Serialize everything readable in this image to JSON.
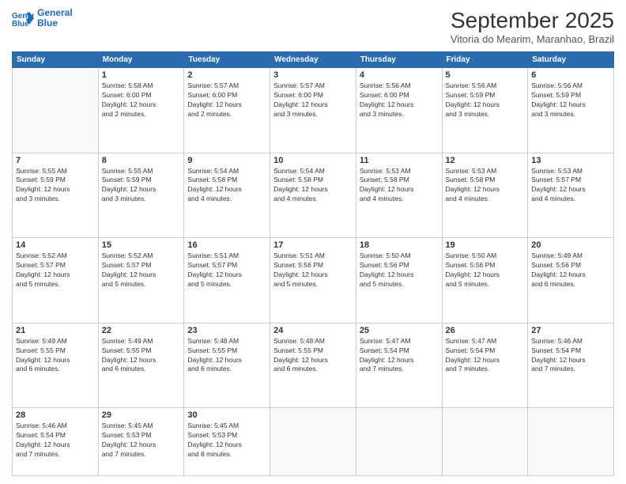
{
  "header": {
    "logo_line1": "General",
    "logo_line2": "Blue",
    "month_title": "September 2025",
    "subtitle": "Vitoria do Mearim, Maranhao, Brazil"
  },
  "days_of_week": [
    "Sunday",
    "Monday",
    "Tuesday",
    "Wednesday",
    "Thursday",
    "Friday",
    "Saturday"
  ],
  "weeks": [
    [
      {
        "day": "",
        "info": ""
      },
      {
        "day": "1",
        "info": "Sunrise: 5:58 AM\nSunset: 6:00 PM\nDaylight: 12 hours\nand 2 minutes."
      },
      {
        "day": "2",
        "info": "Sunrise: 5:57 AM\nSunset: 6:00 PM\nDaylight: 12 hours\nand 2 minutes."
      },
      {
        "day": "3",
        "info": "Sunrise: 5:57 AM\nSunset: 6:00 PM\nDaylight: 12 hours\nand 3 minutes."
      },
      {
        "day": "4",
        "info": "Sunrise: 5:56 AM\nSunset: 6:00 PM\nDaylight: 12 hours\nand 3 minutes."
      },
      {
        "day": "5",
        "info": "Sunrise: 5:56 AM\nSunset: 5:59 PM\nDaylight: 12 hours\nand 3 minutes."
      },
      {
        "day": "6",
        "info": "Sunrise: 5:56 AM\nSunset: 5:59 PM\nDaylight: 12 hours\nand 3 minutes."
      }
    ],
    [
      {
        "day": "7",
        "info": "Sunrise: 5:55 AM\nSunset: 5:59 PM\nDaylight: 12 hours\nand 3 minutes."
      },
      {
        "day": "8",
        "info": "Sunrise: 5:55 AM\nSunset: 5:59 PM\nDaylight: 12 hours\nand 3 minutes."
      },
      {
        "day": "9",
        "info": "Sunrise: 5:54 AM\nSunset: 5:58 PM\nDaylight: 12 hours\nand 4 minutes."
      },
      {
        "day": "10",
        "info": "Sunrise: 5:54 AM\nSunset: 5:58 PM\nDaylight: 12 hours\nand 4 minutes."
      },
      {
        "day": "11",
        "info": "Sunrise: 5:53 AM\nSunset: 5:58 PM\nDaylight: 12 hours\nand 4 minutes."
      },
      {
        "day": "12",
        "info": "Sunrise: 5:53 AM\nSunset: 5:58 PM\nDaylight: 12 hours\nand 4 minutes."
      },
      {
        "day": "13",
        "info": "Sunrise: 5:53 AM\nSunset: 5:57 PM\nDaylight: 12 hours\nand 4 minutes."
      }
    ],
    [
      {
        "day": "14",
        "info": "Sunrise: 5:52 AM\nSunset: 5:57 PM\nDaylight: 12 hours\nand 5 minutes."
      },
      {
        "day": "15",
        "info": "Sunrise: 5:52 AM\nSunset: 5:57 PM\nDaylight: 12 hours\nand 5 minutes."
      },
      {
        "day": "16",
        "info": "Sunrise: 5:51 AM\nSunset: 5:57 PM\nDaylight: 12 hours\nand 5 minutes."
      },
      {
        "day": "17",
        "info": "Sunrise: 5:51 AM\nSunset: 5:56 PM\nDaylight: 12 hours\nand 5 minutes."
      },
      {
        "day": "18",
        "info": "Sunrise: 5:50 AM\nSunset: 5:56 PM\nDaylight: 12 hours\nand 5 minutes."
      },
      {
        "day": "19",
        "info": "Sunrise: 5:50 AM\nSunset: 5:56 PM\nDaylight: 12 hours\nand 5 minutes."
      },
      {
        "day": "20",
        "info": "Sunrise: 5:49 AM\nSunset: 5:56 PM\nDaylight: 12 hours\nand 6 minutes."
      }
    ],
    [
      {
        "day": "21",
        "info": "Sunrise: 5:49 AM\nSunset: 5:55 PM\nDaylight: 12 hours\nand 6 minutes."
      },
      {
        "day": "22",
        "info": "Sunrise: 5:49 AM\nSunset: 5:55 PM\nDaylight: 12 hours\nand 6 minutes."
      },
      {
        "day": "23",
        "info": "Sunrise: 5:48 AM\nSunset: 5:55 PM\nDaylight: 12 hours\nand 6 minutes."
      },
      {
        "day": "24",
        "info": "Sunrise: 5:48 AM\nSunset: 5:55 PM\nDaylight: 12 hours\nand 6 minutes."
      },
      {
        "day": "25",
        "info": "Sunrise: 5:47 AM\nSunset: 5:54 PM\nDaylight: 12 hours\nand 7 minutes."
      },
      {
        "day": "26",
        "info": "Sunrise: 5:47 AM\nSunset: 5:54 PM\nDaylight: 12 hours\nand 7 minutes."
      },
      {
        "day": "27",
        "info": "Sunrise: 5:46 AM\nSunset: 5:54 PM\nDaylight: 12 hours\nand 7 minutes."
      }
    ],
    [
      {
        "day": "28",
        "info": "Sunrise: 5:46 AM\nSunset: 5:54 PM\nDaylight: 12 hours\nand 7 minutes."
      },
      {
        "day": "29",
        "info": "Sunrise: 5:45 AM\nSunset: 5:53 PM\nDaylight: 12 hours\nand 7 minutes."
      },
      {
        "day": "30",
        "info": "Sunrise: 5:45 AM\nSunset: 5:53 PM\nDaylight: 12 hours\nand 8 minutes."
      },
      {
        "day": "",
        "info": ""
      },
      {
        "day": "",
        "info": ""
      },
      {
        "day": "",
        "info": ""
      },
      {
        "day": "",
        "info": ""
      }
    ]
  ]
}
